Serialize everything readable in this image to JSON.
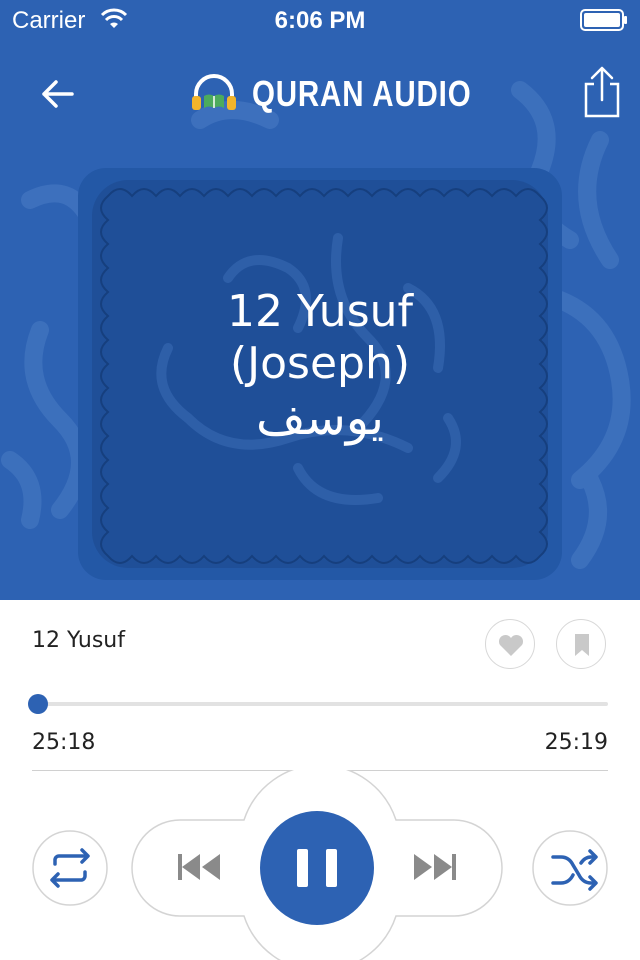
{
  "status_bar": {
    "carrier": "Carrier",
    "time": "6:06 PM",
    "icons": [
      "wifi-icon",
      "battery-icon"
    ]
  },
  "header": {
    "title": "QURAN AUDIO",
    "back_icon": "arrow-left-icon",
    "share_icon": "share-icon",
    "logo_icon": "headphones-book-icon"
  },
  "artwork": {
    "title_line1": "12 Yusuf",
    "title_line2": "(Joseph)",
    "arabic": "يوسف"
  },
  "player": {
    "track_title": "12 Yusuf",
    "favorite_icon": "heart-icon",
    "bookmark_icon": "bookmark-icon",
    "progress": 0.0,
    "elapsed": "25:18",
    "total": "25:19",
    "controls": [
      "repeat-icon",
      "previous-icon",
      "pause-icon",
      "next-icon",
      "shuffle-icon"
    ]
  },
  "colors": {
    "accent": "#2d62b3",
    "card": "#2358a6",
    "card_inner": "#1f4f98",
    "icon_gray": "#8a8a8a"
  }
}
